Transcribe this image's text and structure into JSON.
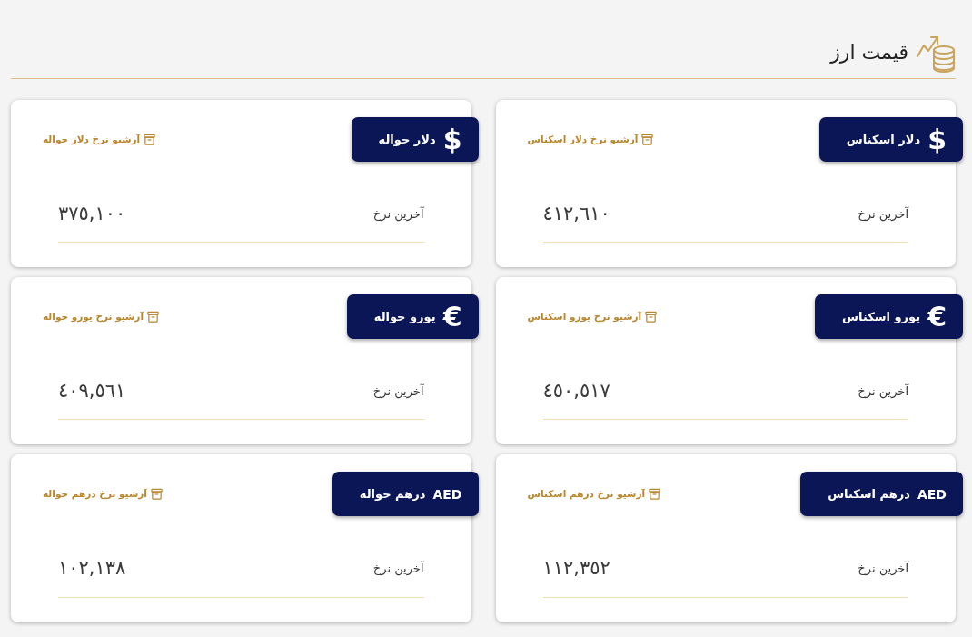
{
  "header": {
    "title": "قیمت ارز"
  },
  "cards": [
    {
      "kind": "sign",
      "symbol": "$",
      "title": "دلار اسکناس",
      "archive_link": "آرشیو نرخ دلار اسکناس",
      "rate_label": "آخرین نرخ",
      "rate": "٤١٢,٦١٠"
    },
    {
      "kind": "sign",
      "symbol": "$",
      "title": "دلار حواله",
      "archive_link": "آرشیو نرخ دلار حواله",
      "rate_label": "آخرین نرخ",
      "rate": "٣٧٥,١٠٠"
    },
    {
      "kind": "sign",
      "symbol": "€",
      "title": "یورو اسکناس",
      "archive_link": "آرشیو نرخ یورو اسکناس",
      "rate_label": "آخرین نرخ",
      "rate": "٤٥٠,٥١٧"
    },
    {
      "kind": "sign",
      "symbol": "€",
      "title": "یورو حواله",
      "archive_link": "آرشیو نرخ یورو حواله",
      "rate_label": "آخرین نرخ",
      "rate": "٤٠٩,٥٦١"
    },
    {
      "kind": "code",
      "symbol": "AED",
      "title": "درهم اسکناس",
      "archive_link": "آرشیو نرخ درهم اسکناس",
      "rate_label": "آخرین نرخ",
      "rate": "١١٢,٣٥٢"
    },
    {
      "kind": "code",
      "symbol": "AED",
      "title": "درهم حواله",
      "archive_link": "آرشیو نرخ درهم حواله",
      "rate_label": "آخرین نرخ",
      "rate": "١٠٢,١٣٨"
    }
  ]
}
